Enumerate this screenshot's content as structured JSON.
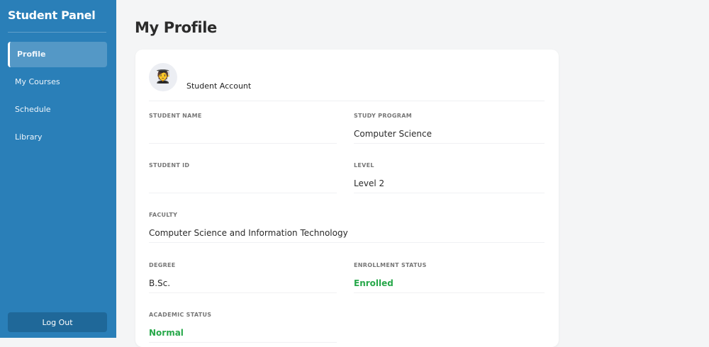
{
  "sidebar": {
    "title": "Student Panel",
    "items": [
      {
        "label": "Profile",
        "active": true
      },
      {
        "label": "My Courses"
      },
      {
        "label": "Schedule"
      },
      {
        "label": "Library"
      }
    ],
    "logout": "Log Out"
  },
  "page": {
    "title": "My Profile"
  },
  "profile": {
    "account_type": "Student Account",
    "avatar_icon": "student-graduate-icon",
    "fields": {
      "student_name": {
        "label": "STUDENT NAME",
        "value": ""
      },
      "study_program": {
        "label": "STUDY PROGRAM",
        "value": "Computer Science"
      },
      "student_id": {
        "label": "STUDENT ID",
        "value": ""
      },
      "level": {
        "label": "LEVEL",
        "value": "Level 2"
      },
      "faculty": {
        "label": "FACULTY",
        "value": "Computer Science and Information Technology"
      },
      "degree": {
        "label": "DEGREE",
        "value": "B.Sc."
      },
      "enrollment_status": {
        "label": "ENROLLMENT STATUS",
        "value": "Enrolled"
      },
      "academic_status": {
        "label": "ACADEMIC STATUS",
        "value": "Normal"
      }
    }
  },
  "colors": {
    "sidebar": "#2a7fb8",
    "status_green": "#27a84a"
  }
}
